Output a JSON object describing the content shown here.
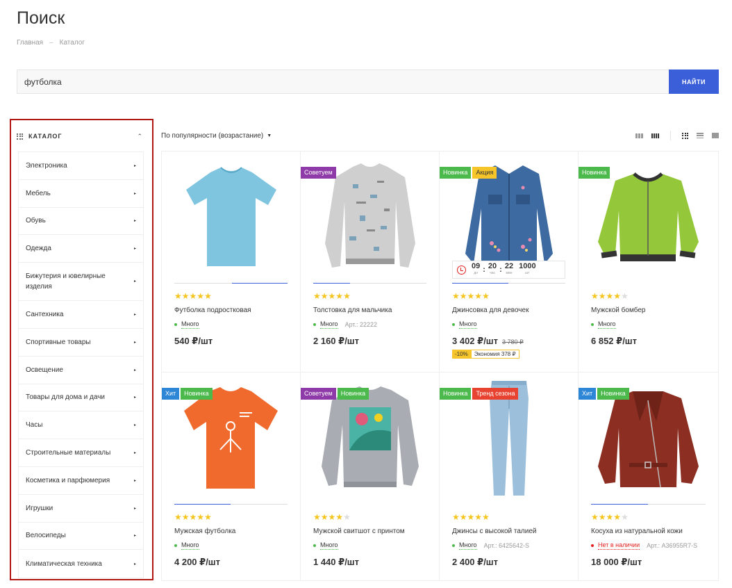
{
  "page": {
    "title": "Поиск"
  },
  "breadcrumb": [
    "Главная",
    "–",
    "Каталог"
  ],
  "search": {
    "value": "футболка",
    "button_label": "НАЙТИ"
  },
  "sidebar": {
    "title": "КАТАЛОГ",
    "items": [
      {
        "label": "Электроника"
      },
      {
        "label": "Мебель"
      },
      {
        "label": "Обувь"
      },
      {
        "label": "Одежда"
      },
      {
        "label": "Бижутерия и ювелирные изделия",
        "tall": true
      },
      {
        "label": "Сантехника"
      },
      {
        "label": "Спортивные товары"
      },
      {
        "label": "Освещение"
      },
      {
        "label": "Товары для дома и дачи"
      },
      {
        "label": "Часы"
      },
      {
        "label": "Строительные материалы"
      },
      {
        "label": "Косметика и парфюмерия"
      },
      {
        "label": "Игрушки"
      },
      {
        "label": "Велосипеды"
      },
      {
        "label": "Климатическая техника"
      }
    ]
  },
  "sort": {
    "label": "По популярности (возрастание)"
  },
  "products": [
    {
      "name": "Футболка подростковая",
      "rating": 5,
      "availability": "Много",
      "art": "",
      "price": "540 ₽/шт",
      "badges": [],
      "image": "tshirt-blue",
      "slider_pos": 1,
      "slider_count": 2
    },
    {
      "name": "Толстовка для мальчика",
      "rating": 5,
      "availability": "Много",
      "art": "Арт.: 22222",
      "price": "2 160 ₽/шт",
      "badges": [
        "Советуем"
      ],
      "image": "sweatshirt-grey",
      "slider_pos": 0,
      "slider_count": 3
    },
    {
      "name": "Джинсовка для девочек",
      "rating": 5,
      "availability": "Много",
      "art": "",
      "price": "3 402 ₽/шт",
      "old_price": "3 780 ₽",
      "discount": "-10%",
      "economy": "Экономия 378 ₽",
      "badges": [
        "Новинка",
        "Акция"
      ],
      "image": "denim-jacket",
      "slider_pos": 0,
      "slider_count": 2,
      "timer": {
        "days": "09",
        "hours": "20",
        "minutes": "22",
        "qty": "1000",
        "days_label": "дн",
        "hours_label": "час",
        "minutes_label": "мин",
        "qty_label": "шт"
      }
    },
    {
      "name": "Мужской бомбер",
      "rating": 4,
      "availability": "Много",
      "art": "",
      "price": "6 852 ₽/шт",
      "badges": [
        "Новинка"
      ],
      "image": "bomber-green",
      "slider_pos": -1,
      "slider_count": 0
    },
    {
      "name": "Мужская футболка",
      "rating": 5,
      "availability": "Много",
      "art": "",
      "price": "4 200 ₽/шт",
      "badges": [
        "Хит",
        "Новинка"
      ],
      "image": "tshirt-orange",
      "slider_pos": 0,
      "slider_count": 2
    },
    {
      "name": "Мужской свитшот с принтом",
      "rating": 4,
      "availability": "Много",
      "art": "",
      "price": "1 440 ₽/шт",
      "badges": [
        "Советуем",
        "Новинка"
      ],
      "image": "sweatshirt-print",
      "slider_pos": -1,
      "slider_count": 0
    },
    {
      "name": "Джинсы с высокой талией",
      "rating": 5,
      "availability": "Много",
      "art": "Арт.: 6425642-S",
      "price": "2 400 ₽/шт",
      "badges": [
        "Новинка",
        "Тренд сезона"
      ],
      "image": "jeans",
      "slider_pos": -1,
      "slider_count": 0
    },
    {
      "name": "Косуха из натуральной кожи",
      "rating": 4,
      "availability": "Нет в наличии",
      "available": false,
      "art": "Арт.: A36955R7-S",
      "price": "18 000 ₽/шт",
      "badges": [
        "Хит",
        "Новинка"
      ],
      "image": "leather-jacket",
      "slider_pos": 0,
      "slider_count": 2
    }
  ],
  "badge_colors": {
    "Советуем": "#8e3aa8",
    "Новинка": "#4cb94c",
    "Акция": "#f6c52a",
    "Хит": "#2e86d6",
    "Тренд сезона": "#e84230"
  },
  "colors": {
    "accent": "#3b5fd9",
    "highlight_border": "#b31414",
    "star": "#f5c51f",
    "in_stock": "#4cb94c",
    "out_of_stock": "#e31e1e"
  }
}
